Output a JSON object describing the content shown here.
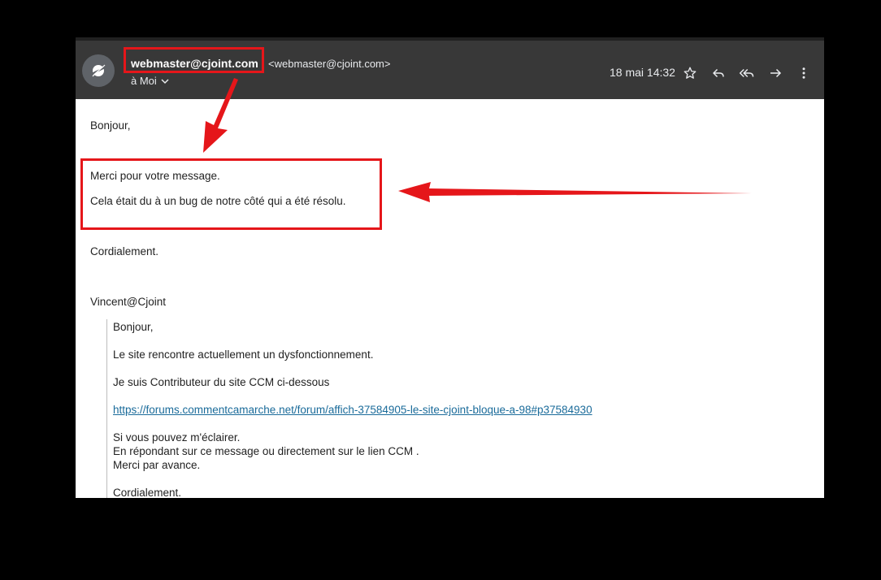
{
  "header": {
    "sender_name": "webmaster@cjoint.com",
    "sender_address": "<webmaster@cjoint.com>",
    "recipient": "à Moi",
    "date": "18 mai 14:32",
    "icons": [
      "cjoint-logo-icon",
      "chevron-down-icon",
      "star-icon",
      "reply-icon",
      "reply-all-icon",
      "forward-icon",
      "more-vert-icon"
    ]
  },
  "body": {
    "greeting": "Bonjour,",
    "line1": "Merci pour votre message.",
    "line2": "Cela était du à un bug de notre côté qui a été résolu.",
    "closing": "Cordialement.",
    "signature": "Vincent@Cjoint"
  },
  "quoted": {
    "greeting": "Bonjour,",
    "line1": "Le site rencontre actuellement un dysfonctionnement.",
    "line2": "Je suis Contributeur du site CCM ci-dessous",
    "link": "https://forums.commentcamarche.net/forum/affich-37584905-le-site-cjoint-bloque-a-98#p37584930",
    "line3": "Si vous pouvez m'éclairer.",
    "line4": "En répondant sur ce message ou directement sur le lien CCM .",
    "line5": "Merci par avance.",
    "closing": "Cordialement."
  },
  "colors": {
    "header_bg": "#383838",
    "annotation": "#e5161a",
    "link": "#1a6b9a"
  }
}
